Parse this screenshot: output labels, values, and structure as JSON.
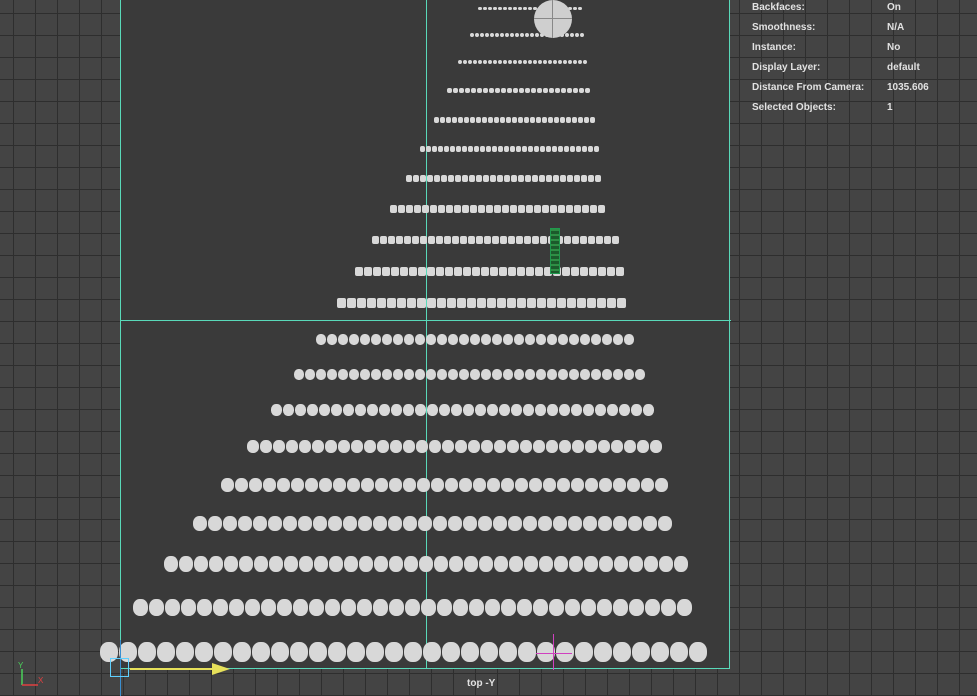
{
  "hud": {
    "rows": [
      {
        "label": "Backfaces:",
        "value": "On"
      },
      {
        "label": "Smoothness:",
        "value": "N/A"
      },
      {
        "label": "Instance:",
        "value": "No"
      },
      {
        "label": "Display Layer:",
        "value": "default"
      },
      {
        "label": "Distance From Camera:",
        "value": "1035.606"
      },
      {
        "label": "Selected Objects:",
        "value": "1"
      }
    ]
  },
  "viewport": {
    "camera_label": "top -Y"
  },
  "colors": {
    "viewport_bg": "#444444",
    "grid_line": "#2e2e2e",
    "film_gate": "#59d9b9",
    "geometry": "#d8d8d8",
    "pivot": "#d040c0",
    "camera_arrow": "#e6e05a",
    "ornament": "#2f8e44"
  },
  "icons": [
    "axis-gizmo-icon",
    "camera-icon",
    "manipulator-pivot-icon",
    "sphere-topper-icon",
    "ornament-icon"
  ]
}
